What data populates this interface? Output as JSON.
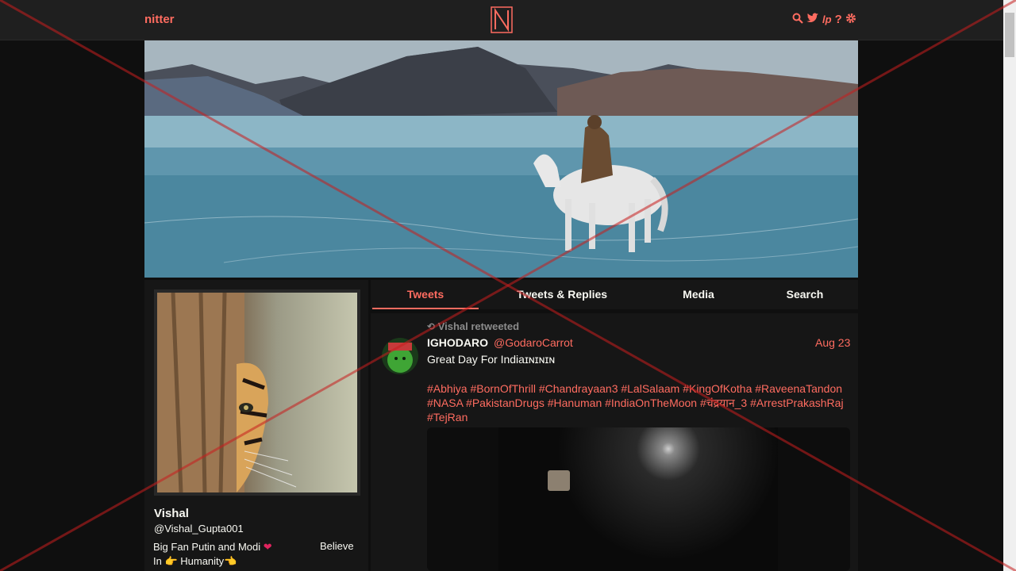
{
  "navbar": {
    "brand": "nitter",
    "logo_letter": "N",
    "icons": [
      "search-icon",
      "twitter-bird-icon",
      "liberapay-icon",
      "help-icon",
      "gear-icon"
    ],
    "icon_glyphs": {
      "help": "?",
      "liberapay": "lp"
    }
  },
  "accent_color": "#ff6c60",
  "profile": {
    "fullname": "Vishal",
    "username": "@Vishal_Gupta001",
    "bio_line1": "Big Fan Putin and Modi",
    "bio_heart": "❤",
    "bio_right": "Believe",
    "bio_line2": "In  👉 Humanity👈"
  },
  "tabs": [
    {
      "label": "Tweets",
      "active": true
    },
    {
      "label": "Tweets & Replies",
      "active": false
    },
    {
      "label": "Media",
      "active": false
    },
    {
      "label": "Search",
      "active": false
    }
  ],
  "tweet": {
    "retweet_header": "Vishal retweeted",
    "fullname": "IGHODARO",
    "handle": "@GodaroCarrot",
    "date": "Aug 23",
    "text": "Great Day For Indiaɪɴɪɴɪɴ",
    "hashtags_line1": "#Abhiya #BornOfThrill #Chandrayaan3 #LalSalaam #KingOfKotha #RaveenaTandon",
    "hashtags_line2": "#NASA #PakistanDrugs #Hanuman  #IndiaOnTheMoon #चंद्रयान_3 #ArrestPrakashRaj",
    "hashtags_line3": "#TejRan"
  }
}
